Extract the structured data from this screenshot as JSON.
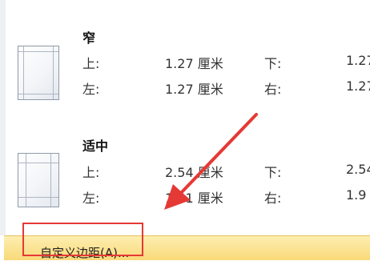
{
  "presets": [
    {
      "title": "窄",
      "top_label": "上:",
      "top_value": "1.27 厘米",
      "bottom_label": "下:",
      "bottom_value": "1.27",
      "left_label": "左:",
      "left_value": "1.27 厘米",
      "right_label": "右:",
      "right_value": "1.27"
    },
    {
      "title": "适中",
      "top_label": "上:",
      "top_value": "2.54 厘米",
      "bottom_label": "下:",
      "bottom_value": "2.54",
      "left_label": "左:",
      "left_value": "1.91 厘米",
      "right_label": "右:",
      "right_value": "1.9"
    }
  ],
  "custom_margins_label": "自定义边距(A)...",
  "colors": {
    "hover_bg": "#fbe29a",
    "annotation": "#e53935"
  }
}
